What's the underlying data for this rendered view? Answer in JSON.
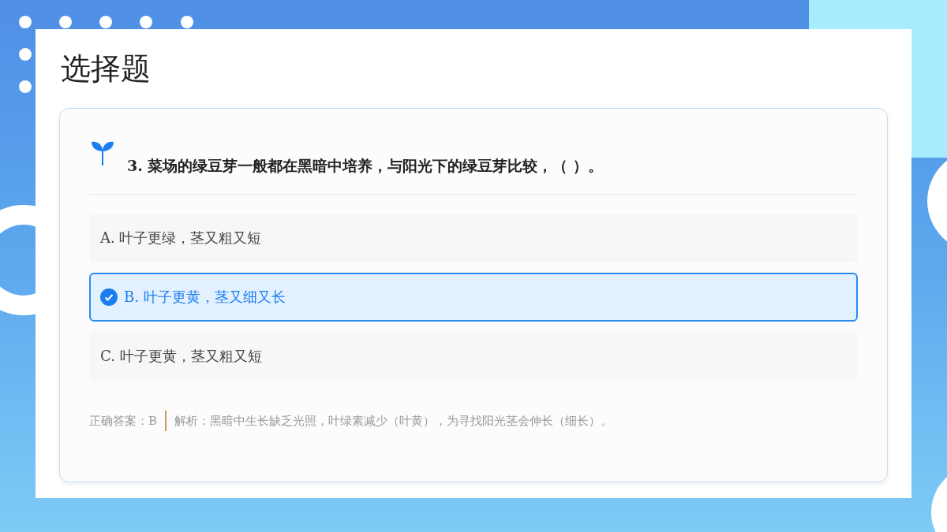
{
  "title": "选择题",
  "question": {
    "number": "3.",
    "text": "菜场的绿豆芽一般都在黑暗中培养，与阳光下的绿豆芽比较，（ ）。"
  },
  "options": [
    {
      "letter": "A.",
      "text": "叶子更绿，茎又粗又短",
      "selected": false
    },
    {
      "letter": "B.",
      "text": "叶子更黄，茎又细又长",
      "selected": true
    },
    {
      "letter": "C.",
      "text": "叶子更黄，茎又粗又短",
      "selected": false
    }
  ],
  "answer": {
    "label": "正确答案：B",
    "analysis": "解析：黑暗中生长缺乏光照，叶绿素减少（叶黄），为寻找阳光茎会伸长（细长）。"
  }
}
